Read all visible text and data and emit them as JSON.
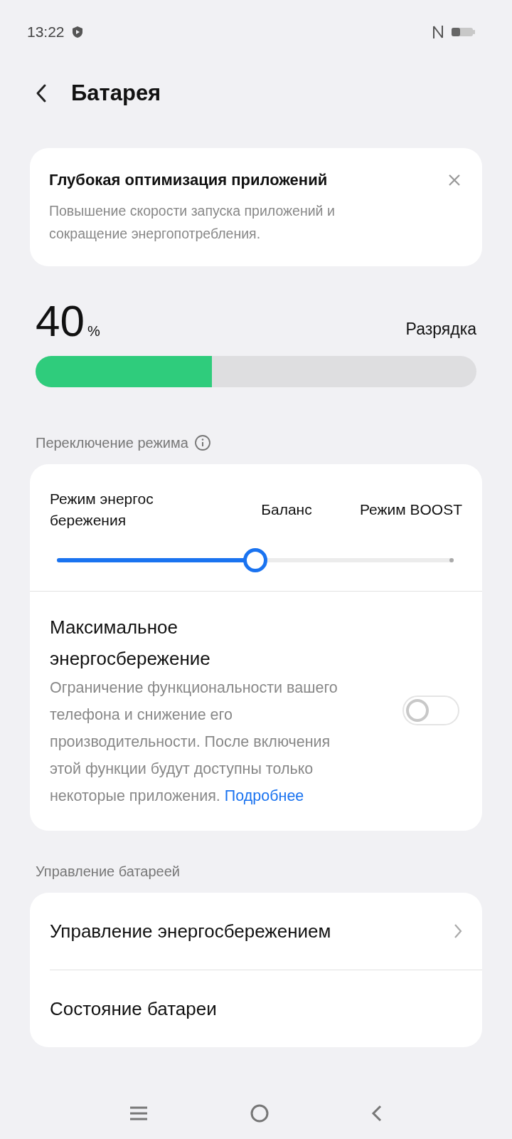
{
  "status_bar": {
    "time": "13:22"
  },
  "header": {
    "title": "Батарея"
  },
  "tip_card": {
    "title": "Глубокая оптимизация приложений",
    "text": "Повышение скорости запуска приложений и сокращение энергопотребления."
  },
  "battery": {
    "percent": "40",
    "unit": "%",
    "status": "Разрядка",
    "level": 0.4
  },
  "mode_section": {
    "title": "Переключение режима",
    "modes": [
      "Режим энергос бережения",
      "Баланс",
      "Режим BOOST"
    ],
    "level": 0.5,
    "max_saving": {
      "title": "Максимальное энергосбережение",
      "text": "Ограничение функциональности вашего телефона и снижение его производительности. После включения этой функции будут доступны только некоторые приложения.",
      "link": "Подробнее",
      "on": false
    }
  },
  "management_section": {
    "title": "Управление батареей",
    "items": [
      {
        "label": "Управление энергосбережением",
        "chevron": true
      },
      {
        "label": "Состояние батареи",
        "chevron": false
      }
    ]
  }
}
